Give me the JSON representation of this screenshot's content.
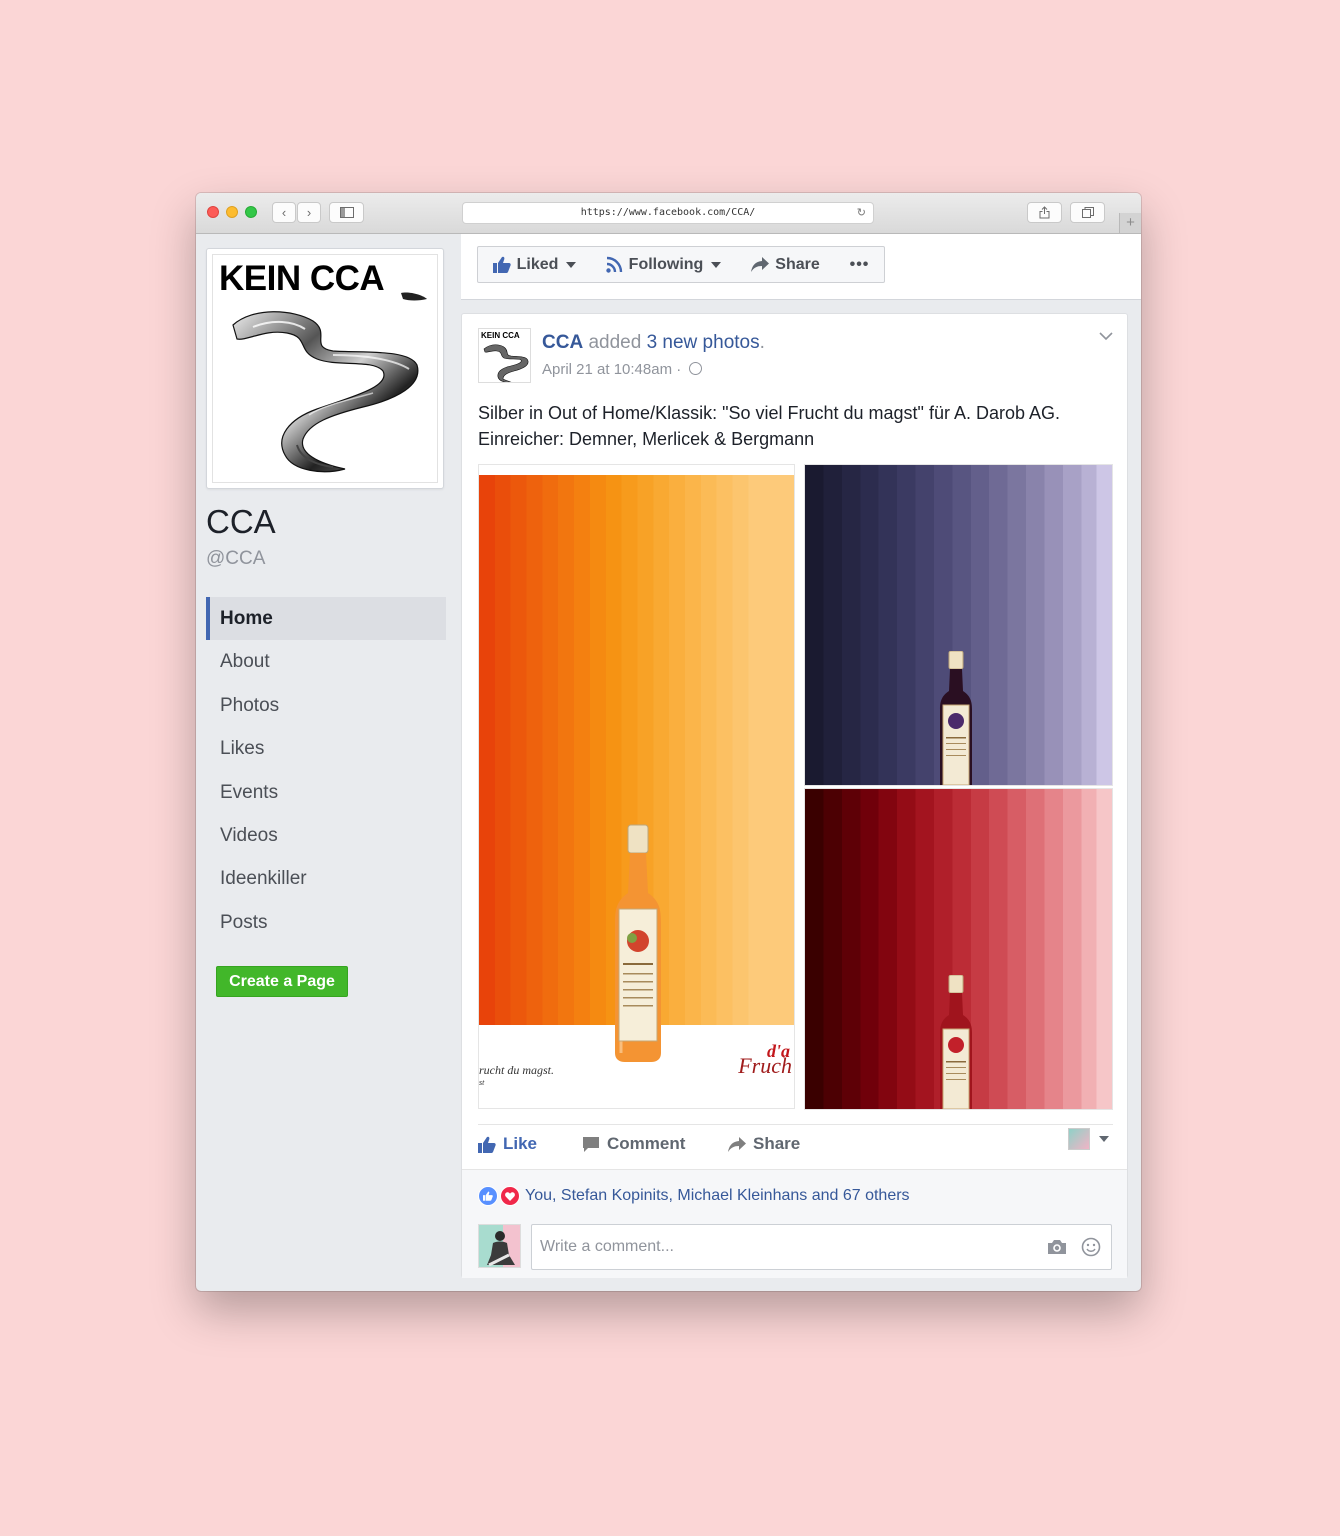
{
  "browser": {
    "url": "https://www.facebook.com/CCA/",
    "new_tab_symbol": "+"
  },
  "page": {
    "logo_text": "KEIN CCA",
    "name": "CCA",
    "handle": "@CCA",
    "nav_items": [
      "Home",
      "About",
      "Photos",
      "Likes",
      "Events",
      "Videos",
      "Ideenkiller",
      "Posts"
    ],
    "active_nav": "Home",
    "create_page_label": "Create a Page"
  },
  "action_bar": {
    "liked_label": "Liked",
    "following_label": "Following",
    "share_label": "Share",
    "more_label": "•••"
  },
  "post": {
    "author": "CCA",
    "action_text": "added",
    "action_link": "3 new photos",
    "action_suffix": ".",
    "avatar_logo": "KEIN CCA",
    "timestamp": "April 21 at 10:48am",
    "timestamp_separator": "·",
    "text_line_1": "Silber in Out of Home/Klassik: \"So viel Frucht du magst\" für A. Darob AG.",
    "text_line_2": "Einreicher: Demner, Merlicek & Bergmann",
    "photo_1_tagline": "rucht du magst.",
    "photo_1_tagline_sub": "st",
    "photo_1_brand": "Fruch",
    "photo_1_brand_mark": "d'a",
    "actions": {
      "like": "Like",
      "comment": "Comment",
      "share": "Share"
    },
    "reactions_text": "You, Stefan Kopinits, Michael Kleinhans and 67 others",
    "comment_placeholder": "Write a comment..."
  },
  "colors": {
    "page_background": "#fbd6d6",
    "facebook_blue": "#4267b2",
    "link_blue": "#365899",
    "create_green": "#42b72a",
    "like_reaction": "#5890ff",
    "love_reaction": "#f0284a"
  },
  "icons": [
    "back-icon",
    "forward-icon",
    "sidebar-icon",
    "reload-icon",
    "share-icon",
    "tabs-icon",
    "thumbs-up-icon",
    "rss-icon",
    "share-arrow-icon",
    "more-icon",
    "globe-icon",
    "chevron-down-icon",
    "comment-icon",
    "camera-icon",
    "emoji-icon",
    "heart-icon"
  ]
}
